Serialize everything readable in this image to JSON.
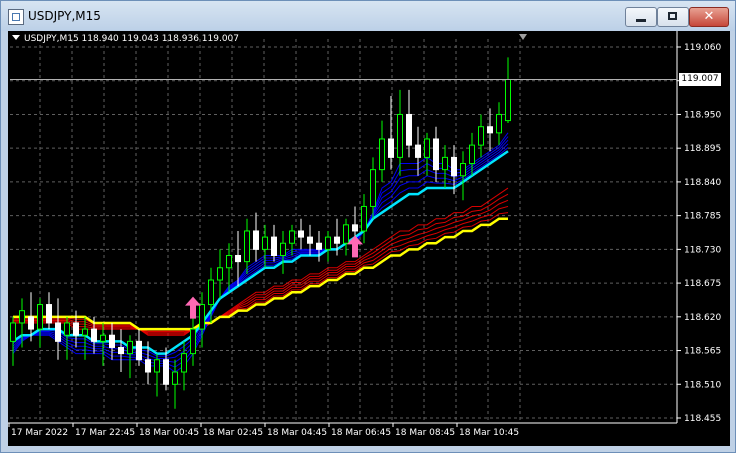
{
  "window": {
    "title": "USDJPY,M15",
    "minimize_icon": "minimize-icon",
    "maximize_icon": "maximize-icon",
    "close_icon": "close-icon",
    "close_glyph": "✕"
  },
  "chart": {
    "symbol_line": "USDJPY,M15  118.940 119.043 118.936 119.007",
    "current_price": "119.007",
    "price_axis": [
      "119.060",
      "119.005",
      "118.950",
      "118.895",
      "118.840",
      "118.785",
      "118.730",
      "118.675",
      "118.620",
      "118.565",
      "118.510",
      "118.455"
    ],
    "time_axis": [
      "17 Mar 2022",
      "17 Mar 22:45",
      "18 Mar 00:45",
      "18 Mar 02:45",
      "18 Mar 04:45",
      "18 Mar 06:45",
      "18 Mar 08:45",
      "18 Mar 10:45"
    ],
    "colors": {
      "background": "#000000",
      "grid": "#5f5f5f",
      "bull": "#00ff00",
      "bear": "#ffffff",
      "ema_fast": "#0000ff",
      "ema_mid": "#00e5ff",
      "ema_slow": "#ff0000",
      "ema_base": "#ffff00",
      "arrow": "#ff69b4"
    }
  },
  "chart_data": {
    "type": "candlestick",
    "symbol": "USDJPY",
    "timeframe": "M15",
    "last_bar": {
      "open": 118.94,
      "high": 119.043,
      "low": 118.936,
      "close": 119.007
    },
    "ylim": [
      118.455,
      119.06
    ],
    "x_tick_labels": [
      "17 Mar 2022",
      "17 Mar 22:45",
      "18 Mar 00:45",
      "18 Mar 02:45",
      "18 Mar 04:45",
      "18 Mar 06:45",
      "18 Mar 08:45",
      "18 Mar 10:45"
    ],
    "y_tick_labels": [
      "119.060",
      "119.005",
      "118.950",
      "118.895",
      "118.840",
      "118.785",
      "118.730",
      "118.675",
      "118.620",
      "118.565",
      "118.510",
      "118.455"
    ],
    "grid": true,
    "candles": [
      [
        118.58,
        118.62,
        118.54,
        118.61
      ],
      [
        118.61,
        118.65,
        118.57,
        118.63
      ],
      [
        118.62,
        118.66,
        118.58,
        118.6
      ],
      [
        118.6,
        118.65,
        118.57,
        118.64
      ],
      [
        118.64,
        118.66,
        118.6,
        118.61
      ],
      [
        118.61,
        118.65,
        118.55,
        118.58
      ],
      [
        118.59,
        118.62,
        118.55,
        118.61
      ],
      [
        118.61,
        118.63,
        118.57,
        118.59
      ],
      [
        118.59,
        118.62,
        118.55,
        118.6
      ],
      [
        118.6,
        118.62,
        118.56,
        118.58
      ],
      [
        118.58,
        118.61,
        118.54,
        118.59
      ],
      [
        118.59,
        118.61,
        118.55,
        118.57
      ],
      [
        118.57,
        118.6,
        118.53,
        118.56
      ],
      [
        118.56,
        118.59,
        118.52,
        118.58
      ],
      [
        118.58,
        118.6,
        118.54,
        118.55
      ],
      [
        118.55,
        118.58,
        118.51,
        118.53
      ],
      [
        118.53,
        118.56,
        118.49,
        118.55
      ],
      [
        118.55,
        118.57,
        118.5,
        118.51
      ],
      [
        118.51,
        118.55,
        118.47,
        118.53
      ],
      [
        118.53,
        118.58,
        118.5,
        118.56
      ],
      [
        118.56,
        118.62,
        118.54,
        118.6
      ],
      [
        118.6,
        118.66,
        118.57,
        118.64
      ],
      [
        118.64,
        118.7,
        118.61,
        118.68
      ],
      [
        118.68,
        118.73,
        118.65,
        118.7
      ],
      [
        118.7,
        118.74,
        118.66,
        118.72
      ],
      [
        118.72,
        118.76,
        118.67,
        118.71
      ],
      [
        118.71,
        118.78,
        118.69,
        118.76
      ],
      [
        118.76,
        118.79,
        118.71,
        118.73
      ],
      [
        118.73,
        118.77,
        118.7,
        118.75
      ],
      [
        118.75,
        118.77,
        118.71,
        118.72
      ],
      [
        118.72,
        118.76,
        118.69,
        118.74
      ],
      [
        118.74,
        118.77,
        118.72,
        118.76
      ],
      [
        118.76,
        118.78,
        118.73,
        118.75
      ],
      [
        118.75,
        118.77,
        118.72,
        118.74
      ],
      [
        118.74,
        118.76,
        118.71,
        118.73
      ],
      [
        118.73,
        118.76,
        118.71,
        118.75
      ],
      [
        118.75,
        118.78,
        118.72,
        118.74
      ],
      [
        118.74,
        118.78,
        118.72,
        118.77
      ],
      [
        118.77,
        118.8,
        118.74,
        118.76
      ],
      [
        118.76,
        118.82,
        118.74,
        118.8
      ],
      [
        118.8,
        118.88,
        118.78,
        118.86
      ],
      [
        118.86,
        118.94,
        118.84,
        118.91
      ],
      [
        118.91,
        118.98,
        118.86,
        118.88
      ],
      [
        118.88,
        118.99,
        118.85,
        118.95
      ],
      [
        118.95,
        118.99,
        118.88,
        118.9
      ],
      [
        118.9,
        118.93,
        118.85,
        118.88
      ],
      [
        118.88,
        118.92,
        118.85,
        118.91
      ],
      [
        118.91,
        118.93,
        118.84,
        118.86
      ],
      [
        118.86,
        118.9,
        118.83,
        118.88
      ],
      [
        118.88,
        118.9,
        118.82,
        118.85
      ],
      [
        118.85,
        118.89,
        118.81,
        118.87
      ],
      [
        118.87,
        118.92,
        118.85,
        118.9
      ],
      [
        118.9,
        118.95,
        118.88,
        118.93
      ],
      [
        118.93,
        118.96,
        118.89,
        118.92
      ],
      [
        118.92,
        118.97,
        118.9,
        118.95
      ],
      [
        118.94,
        119.043,
        118.936,
        119.007
      ]
    ],
    "series": [
      {
        "values": [
          118.56,
          118.58,
          118.59,
          118.59,
          118.59,
          118.58,
          118.57,
          118.56,
          118.56,
          118.56,
          118.56,
          118.55,
          118.55,
          118.55,
          118.55,
          118.54,
          118.54,
          118.54,
          118.53,
          118.54,
          118.56,
          118.59,
          118.62,
          118.65,
          118.67,
          118.68,
          118.7,
          118.71,
          118.72,
          118.72,
          118.72,
          118.73,
          118.73,
          118.73,
          118.73,
          118.73,
          118.73,
          118.74,
          118.74,
          118.76,
          118.79,
          118.83,
          118.84,
          118.87,
          118.87,
          118.87,
          118.88,
          118.87,
          118.87,
          118.86,
          118.86,
          118.87,
          118.88,
          118.89,
          118.9,
          118.92
        ]
      },
      {
        "values": [
          118.58,
          118.59,
          118.59,
          118.6,
          118.6,
          118.6,
          118.59,
          118.59,
          118.59,
          118.58,
          118.58,
          118.58,
          118.58,
          118.57,
          118.57,
          118.57,
          118.56,
          118.56,
          118.57,
          118.58,
          118.59,
          118.61,
          118.63,
          118.65,
          118.66,
          118.67,
          118.68,
          118.69,
          118.7,
          118.7,
          118.71,
          118.71,
          118.72,
          118.72,
          118.72,
          118.73,
          118.73,
          118.74,
          118.75,
          118.76,
          118.78,
          118.79,
          118.8,
          118.81,
          118.82,
          118.82,
          118.83,
          118.83,
          118.83,
          118.83,
          118.84,
          118.85,
          118.86,
          118.87,
          118.88,
          118.89
        ]
      },
      {
        "values": [
          118.61,
          118.61,
          118.61,
          118.61,
          118.61,
          118.61,
          118.61,
          118.6,
          118.6,
          118.6,
          118.6,
          118.6,
          118.6,
          118.6,
          118.6,
          118.59,
          118.59,
          118.59,
          118.59,
          118.59,
          118.6,
          118.6,
          118.61,
          118.62,
          118.63,
          118.64,
          118.65,
          118.66,
          118.66,
          118.67,
          118.67,
          118.68,
          118.68,
          118.69,
          118.69,
          118.7,
          118.7,
          118.71,
          118.71,
          118.72,
          118.73,
          118.74,
          118.75,
          118.76,
          118.76,
          118.77,
          118.77,
          118.78,
          118.78,
          118.79,
          118.79,
          118.8,
          118.8,
          118.81,
          118.82,
          118.83
        ]
      },
      {
        "values": [
          118.62,
          118.62,
          118.62,
          118.62,
          118.62,
          118.62,
          118.62,
          118.62,
          118.62,
          118.61,
          118.61,
          118.61,
          118.61,
          118.61,
          118.6,
          118.6,
          118.6,
          118.6,
          118.6,
          118.6,
          118.6,
          118.61,
          118.61,
          118.62,
          118.62,
          118.63,
          118.63,
          118.64,
          118.64,
          118.65,
          118.65,
          118.66,
          118.66,
          118.67,
          118.67,
          118.68,
          118.68,
          118.69,
          118.69,
          118.7,
          118.7,
          118.71,
          118.72,
          118.72,
          118.73,
          118.73,
          118.74,
          118.74,
          118.75,
          118.75,
          118.76,
          118.76,
          118.77,
          118.77,
          118.78,
          118.78
        ]
      }
    ],
    "arrows": [
      {
        "bar": 20,
        "price": 118.63
      },
      {
        "bar": 38,
        "price": 118.73
      }
    ]
  }
}
